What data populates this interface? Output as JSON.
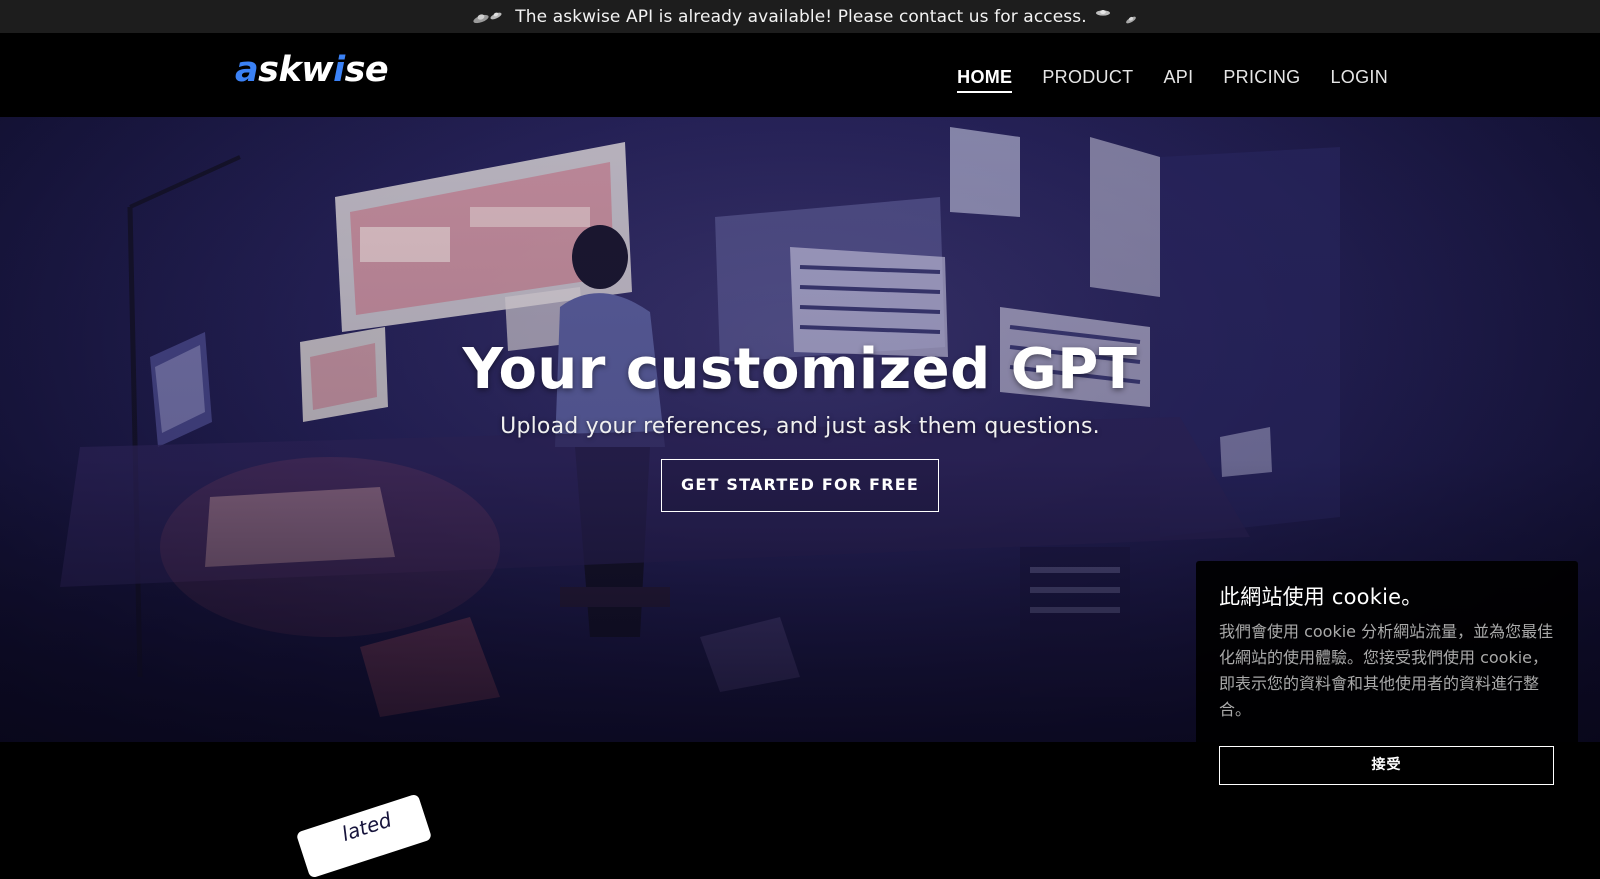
{
  "announcement": {
    "text": "The askwise API is already available! Please contact us for access.",
    "icons": [
      "ufo-icon",
      "ufo-icon"
    ]
  },
  "header": {
    "logo": {
      "prefix": "a",
      "mid1": "skw",
      "accent": "i",
      "suffix": "se"
    },
    "nav": [
      {
        "label": "HOME",
        "active": true
      },
      {
        "label": "PRODUCT",
        "active": false
      },
      {
        "label": "API",
        "active": false
      },
      {
        "label": "PRICING",
        "active": false
      },
      {
        "label": "LOGIN",
        "active": false
      }
    ]
  },
  "hero": {
    "title": "Your customized GPT",
    "subtitle": "Upload your references, and just ask them questions.",
    "cta_label": "GET STARTED FOR FREE"
  },
  "below": {
    "tag_partial": "lated"
  },
  "cookie": {
    "title": "此網站使用 cookie。",
    "body": "我們會使用 cookie 分析網站流量，並為您最佳化網站的使用體驗。您接受我們使用 cookie，即表示您的資料會和其他使用者的資料進行整合。",
    "accept_label": "接受"
  },
  "colors": {
    "accent": "#3b82f6",
    "announcement_bg": "#1d1d1d",
    "header_bg": "#000000",
    "hero_tint": "#262258"
  }
}
